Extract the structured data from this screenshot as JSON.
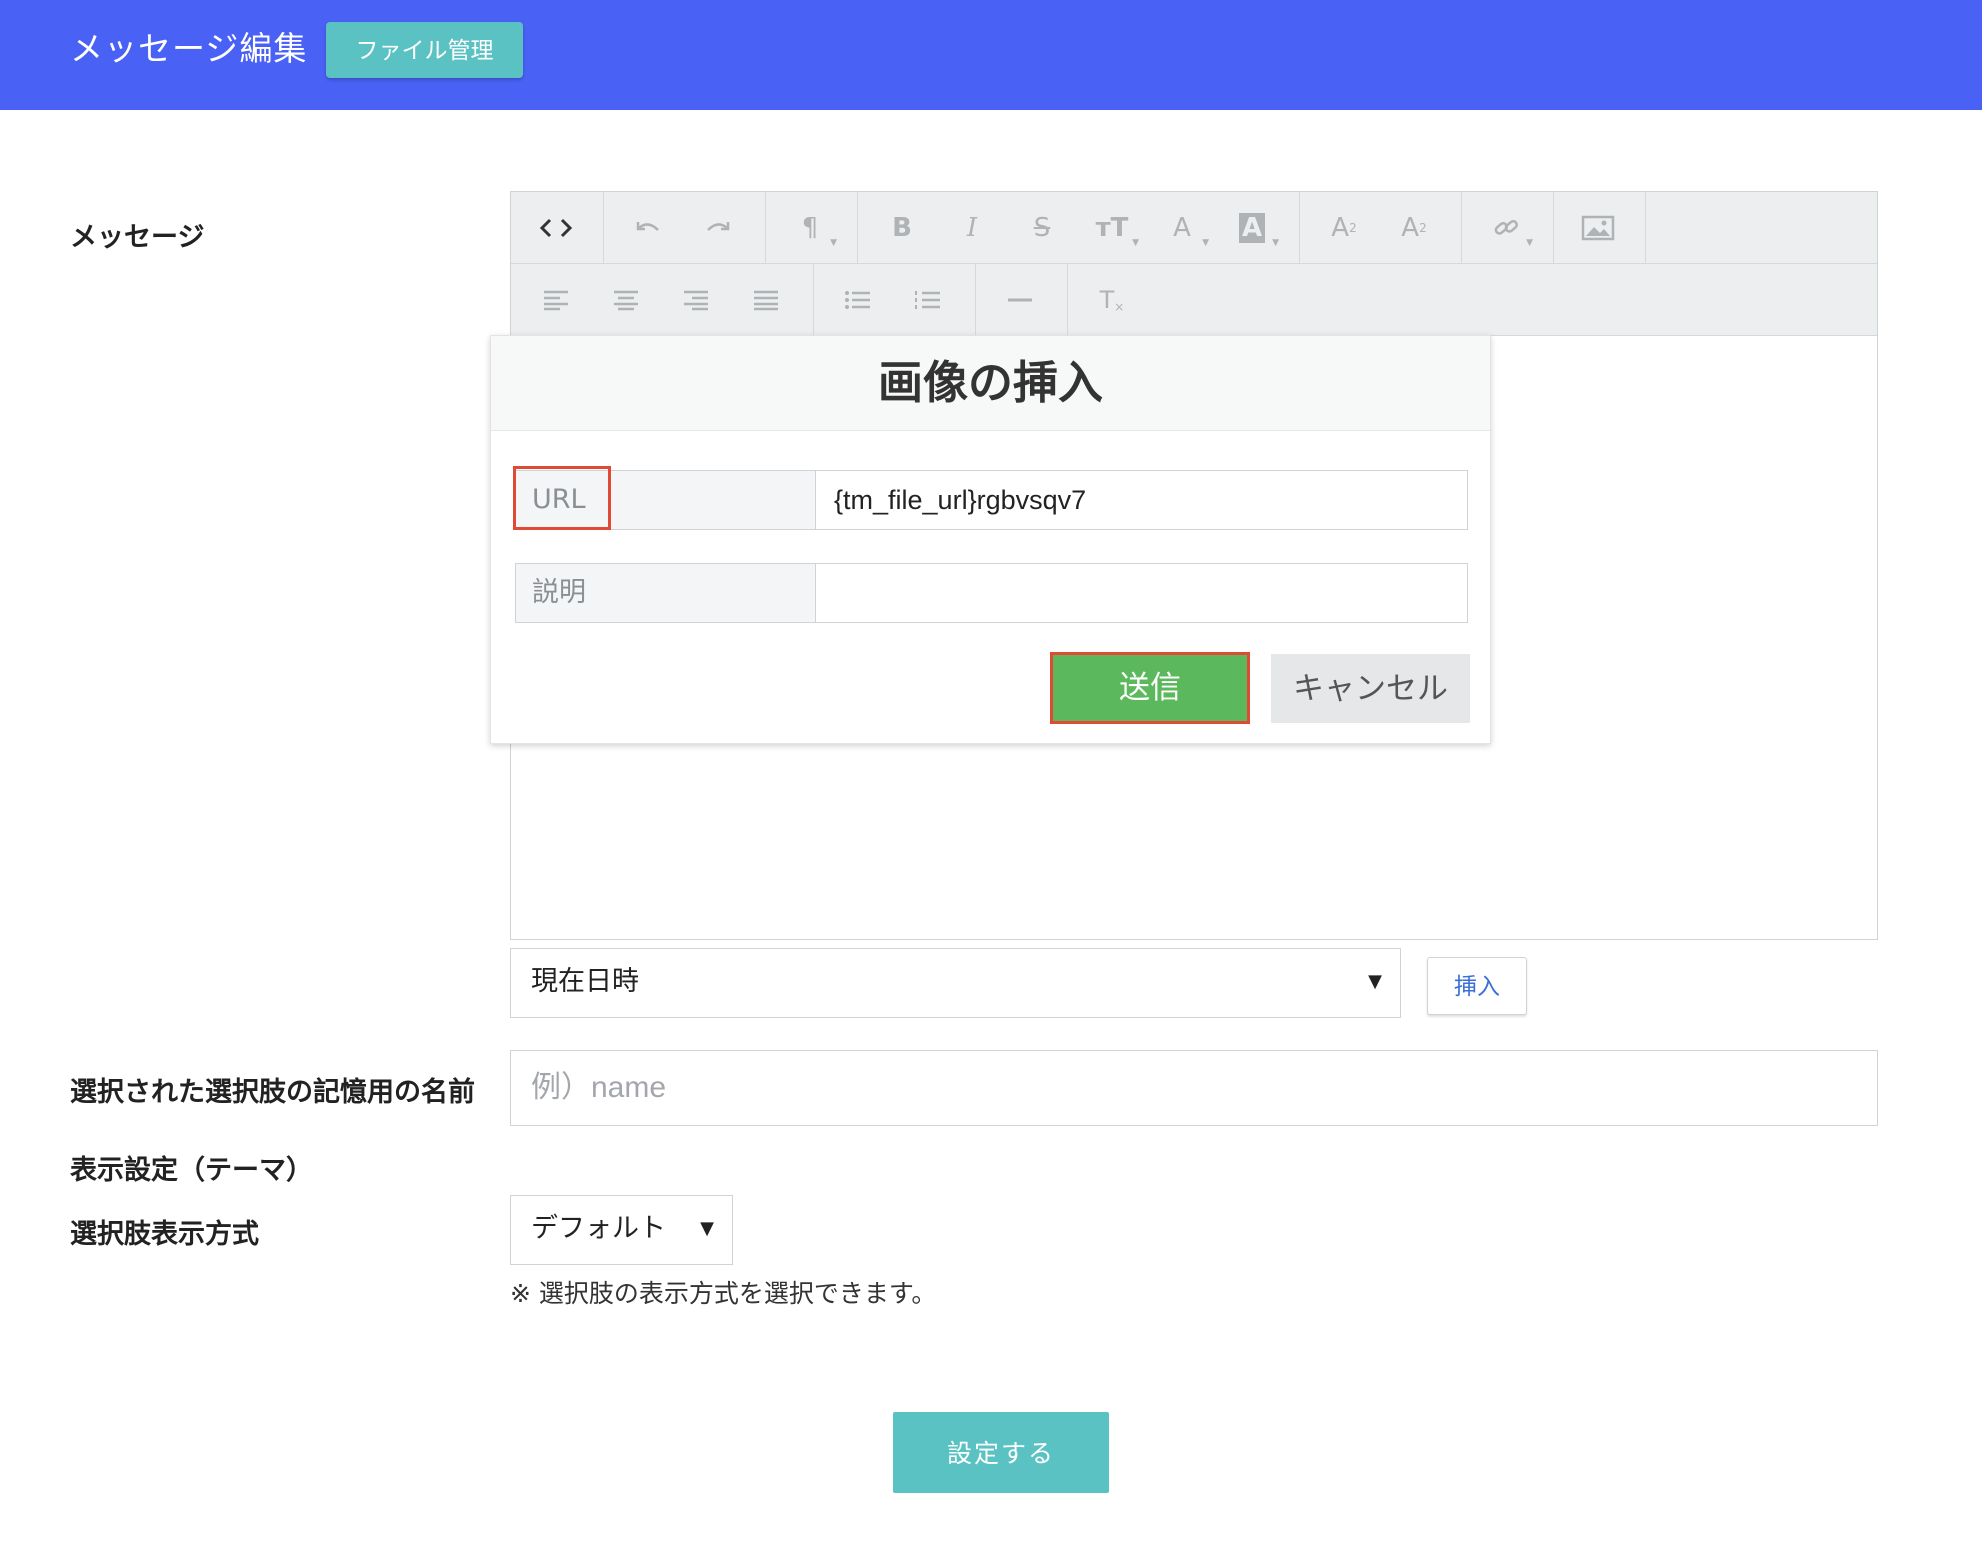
{
  "header": {
    "title": "メッセージ編集",
    "file_button": "ファイル管理",
    "bg_color": "#4a61f5"
  },
  "labels": {
    "message": "メッセージ",
    "memory_name": "選択された選択肢の記憶用の名前",
    "theme": "表示設定（テーマ）",
    "choice_display": "選択肢表示方式"
  },
  "editor": {
    "toolbar_row1": [
      "code-view-icon",
      "undo-icon",
      "redo-icon",
      "paragraph-icon",
      "bold-icon",
      "italic-icon",
      "strikethrough-icon",
      "font-size-icon",
      "font-color-icon",
      "highlight-color-icon",
      "superscript-icon",
      "subscript-icon",
      "link-icon",
      "image-icon"
    ],
    "toolbar_row2": [
      "align-left-icon",
      "align-center-icon",
      "align-right-icon",
      "align-justify-icon",
      "unordered-list-icon",
      "ordered-list-icon",
      "horizontal-rule-icon",
      "clear-format-icon"
    ]
  },
  "dialog": {
    "title": "画像の挿入",
    "url_label": "URL",
    "url_value": "{tm_file_url}rgbvsqv7",
    "desc_label": "説明",
    "desc_value": "",
    "send_label": "送信",
    "cancel_label": "キャンセル"
  },
  "variable_select": {
    "selected": "現在日時",
    "insert_label": "挿入"
  },
  "memory_name_input": {
    "placeholder": "例）name",
    "value": ""
  },
  "choice_display_select": {
    "selected": "デフォルト"
  },
  "note": "※ 選択肢の表示方式を選択できます。",
  "submit_label": "設定する",
  "colors": {
    "accent_teal": "#5bc2c3",
    "send_green": "#5cb85c",
    "highlight_red": "#e04a35"
  }
}
